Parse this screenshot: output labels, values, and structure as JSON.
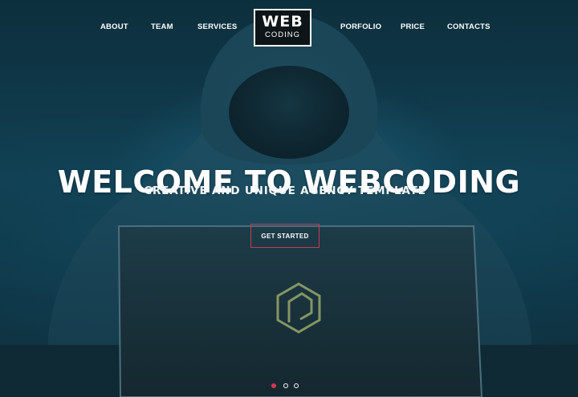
{
  "nav": {
    "items": [
      {
        "label": "ABOUT"
      },
      {
        "label": "TEAM"
      },
      {
        "label": "SERVICES"
      },
      {
        "label": "PORFOLIO"
      },
      {
        "label": "PRICE"
      },
      {
        "label": "CONTACTS"
      }
    ],
    "logo": {
      "line1": "WEB",
      "line2": "CODING"
    }
  },
  "hero": {
    "headline": "WELCOME TO WEBCODING",
    "subheadline": "CREATIVE AND UNIQUE AGENCY TEMPLATE",
    "cta_label": "GET STARTED"
  },
  "slider": {
    "count": 3,
    "active_index": 0
  },
  "colors": {
    "accent": "#d13a52",
    "text": "#ffffff",
    "background": "#0e3344"
  }
}
